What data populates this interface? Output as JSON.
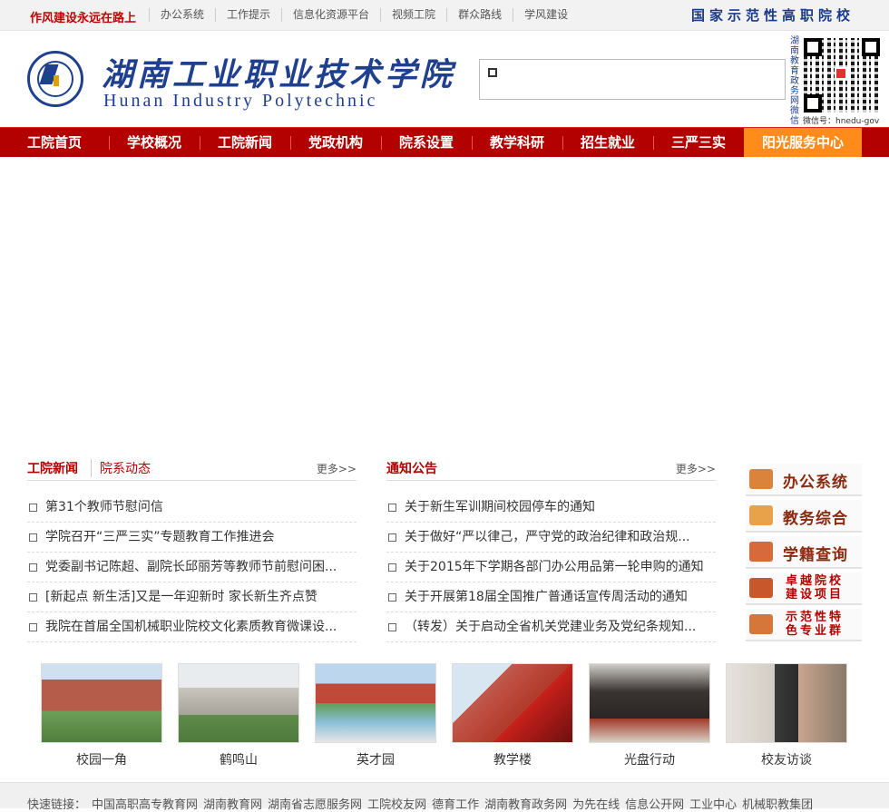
{
  "topbar": {
    "slogan": "作风建设永远在路上",
    "links": [
      "办公系统",
      "工作提示",
      "信息化资源平台",
      "视频工院",
      "群众路线",
      "学风建设"
    ],
    "badge": "国家示范性高职院校"
  },
  "header": {
    "logo_cn": "湖南工业职业技术学院",
    "logo_en": "Hunan Industry Polytechnic",
    "qr_side_text": "湖南教育政务网微信",
    "qr_caption": "微信号：hnedu-gov"
  },
  "nav": [
    "工院首页",
    "学校概况",
    "工院新闻",
    "党政机构",
    "院系设置",
    "教学科研",
    "招生就业",
    "三严三实",
    "阳光服务中心"
  ],
  "news": {
    "tab1": "工院新闻",
    "tab2": "院系动态",
    "more": "更多>>",
    "items": [
      "第31个教师节慰问信",
      "学院召开“三严三实”专题教育工作推进会",
      "党委副书记陈超、副院长邱丽芳等教师节前慰问困...",
      "[新起点 新生活]又是一年迎新时 家长新生齐点赞",
      "我院在首届全国机械职业院校文化素质教育微课设..."
    ]
  },
  "notice": {
    "title": "通知公告",
    "more": "更多>>",
    "items": [
      "关于新生军训期间校园停车的通知",
      "关于做好“严以律己，严守党的政治纪律和政治规...",
      "关于2015年下学期各部门办公用品第一轮申购的通知",
      "关于开展第18届全国推广普通话宣传周活动的通知",
      "（转发）关于启动全省机关党建业务及党纪条规知..."
    ]
  },
  "quick": {
    "q1": "办公系统",
    "q2": "教务综合",
    "q3": "学籍查询",
    "q4a": "卓越院校",
    "q4b": "建设项目",
    "q5a": "示范性特",
    "q5b": "色专业群"
  },
  "photos": [
    "校园一角",
    "鹤鸣山",
    "英才园",
    "教学楼",
    "光盘行动",
    "校友访谈"
  ],
  "footer": {
    "label": "快速链接：",
    "links": [
      "中国高职高专教育网",
      "湖南教育网",
      "湖南省志愿服务网",
      "工院校友网",
      "德育工作",
      "湖南教育政务网",
      "为先在线",
      "信息公开网",
      "工业中心",
      "机械职教集团"
    ]
  }
}
